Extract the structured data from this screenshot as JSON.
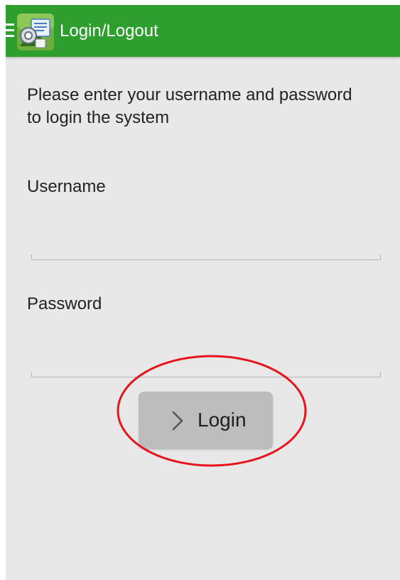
{
  "app_bar": {
    "title": "Login/Logout",
    "menu_icon": "hamburger-menu-icon",
    "logo_icon": "app-logo-icon",
    "background_color": "#2e9e2e",
    "text_color": "#ffffff"
  },
  "form": {
    "instructions": "Please enter your username and password to login the system",
    "username": {
      "label": "Username",
      "value": "",
      "placeholder": ""
    },
    "password": {
      "label": "Password",
      "value": "",
      "placeholder": ""
    },
    "login_button": {
      "label": "Login",
      "icon": "chevron-right-icon",
      "background_color": "#bdbdbd"
    }
  },
  "annotation": {
    "shape": "ellipse",
    "color": "#e8141b",
    "target": "login_button"
  },
  "colors": {
    "screen_background": "#e8e8e8",
    "field_underline": "#b5b5b5"
  }
}
